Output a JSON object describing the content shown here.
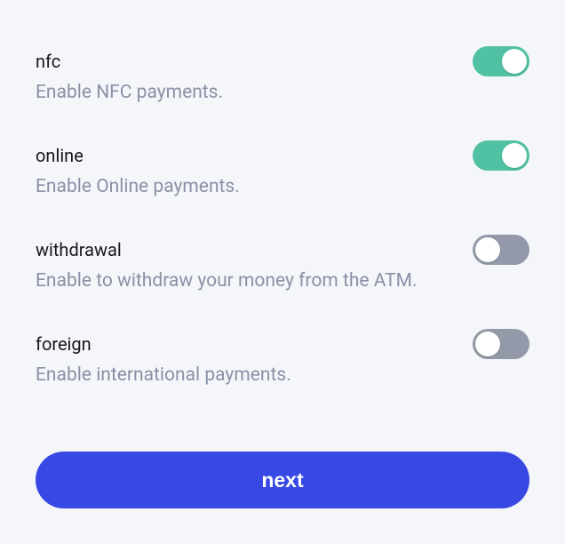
{
  "settings": [
    {
      "key": "nfc",
      "title": "nfc",
      "description": "Enable NFC payments.",
      "enabled": true
    },
    {
      "key": "online",
      "title": "online",
      "description": "Enable Online payments.",
      "enabled": true
    },
    {
      "key": "withdrawal",
      "title": "withdrawal",
      "description": "Enable to withdraw your money from the ATM.",
      "enabled": false
    },
    {
      "key": "foreign",
      "title": "foreign",
      "description": "Enable international payments.",
      "enabled": false
    }
  ],
  "actions": {
    "next_label": "next"
  }
}
